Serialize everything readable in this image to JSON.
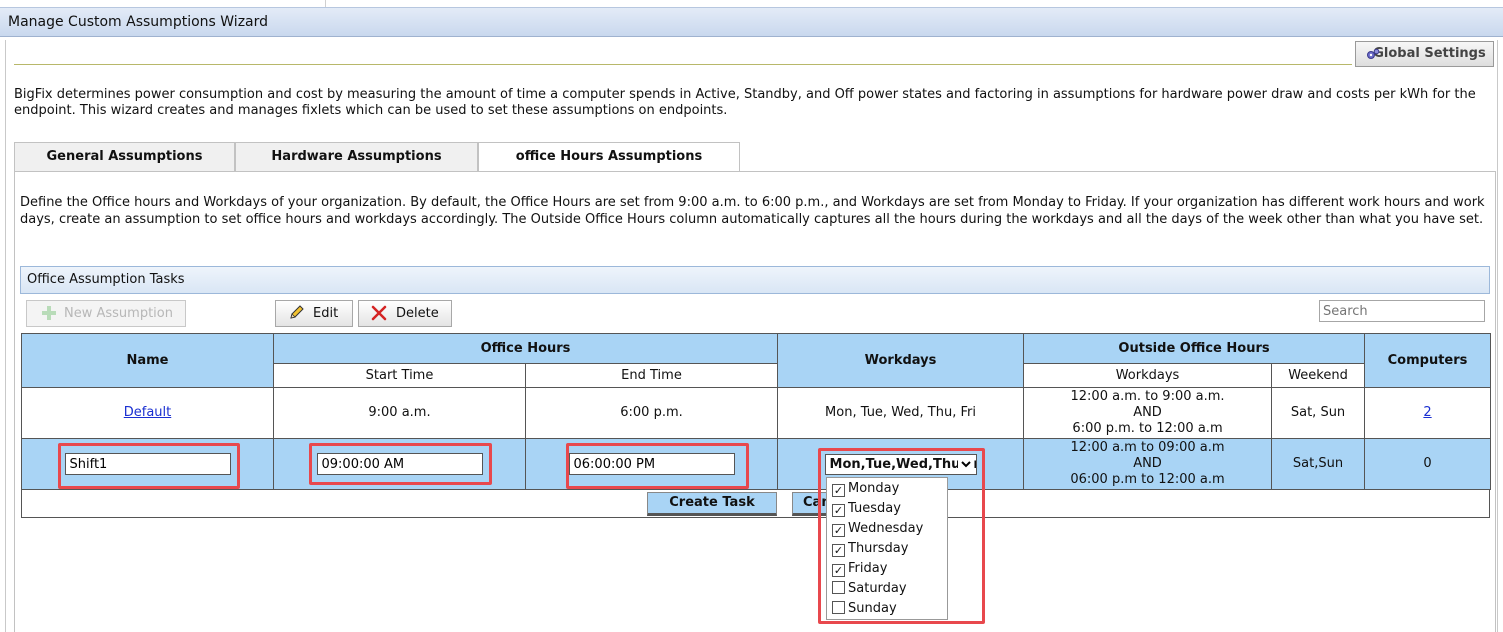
{
  "window": {
    "title": "Manage Custom Assumptions Wizard"
  },
  "header": {
    "global_settings_label": "Global Settings"
  },
  "intro": "BigFix determines power consumption and cost by measuring the amount of time a computer spends in Active, Standby, and Off power states and factoring in assumptions for hardware power draw and costs per kWh for the endpoint. This wizard creates and manages fixlets which can be used to set these assumptions on endpoints.",
  "tabs": [
    {
      "label": "General Assumptions"
    },
    {
      "label": "Hardware Assumptions"
    },
    {
      "label": "office Hours Assumptions"
    }
  ],
  "description": "Define the Office hours and Workdays of your organization. By default, the Office Hours are set from 9:00 a.m. to 6:00 p.m., and Workdays are set from Monday to Friday. If your organization has different work hours and work days, create an assumption to set office hours and workdays accordingly. The Outside Office Hours column automatically captures all the hours during the workdays and all the days of the week other than what you have set.",
  "tasks": {
    "title": "Office Assumption Tasks",
    "new_label": "New Assumption",
    "edit_label": "Edit",
    "delete_label": "Delete",
    "search_placeholder": "Search"
  },
  "table": {
    "headers": {
      "name": "Name",
      "office_hours": "Office Hours",
      "start_time": "Start Time",
      "end_time": "End Time",
      "workdays": "Workdays",
      "outside": "Outside Office Hours",
      "outside_workdays": "Workdays",
      "weekend": "Weekend",
      "computers": "Computers"
    },
    "default_row": {
      "name": "Default",
      "start": "9:00 a.m.",
      "end": "6:00 p.m.",
      "workdays": "Mon, Tue, Wed, Thu, Fri",
      "outside_line1": "12:00 a.m. to 9:00 a.m.",
      "outside_line2": "AND",
      "outside_line3": "6:00 p.m. to 12:00 a.m",
      "weekend": "Sat, Sun",
      "computers": "2"
    },
    "edit_row": {
      "name": "Shift1",
      "start": "09:00:00 AM",
      "end": "06:00:00 PM",
      "workdays_selected": "Mon,Tue,Wed,Thu,Fri",
      "outside_line1": "12:00 a.m to 09:00 a.m",
      "outside_line2": "AND",
      "outside_line3": "06:00 p.m to 12:00 a.m",
      "weekend": "Sat,Sun",
      "computers": "0"
    }
  },
  "actions": {
    "create_label": "Create Task",
    "cancel_label": "Cancel"
  },
  "workday_options": [
    {
      "label": "Monday",
      "checked": true
    },
    {
      "label": "Tuesday",
      "checked": true
    },
    {
      "label": "Wednesday",
      "checked": true
    },
    {
      "label": "Thursday",
      "checked": true
    },
    {
      "label": "Friday",
      "checked": true
    },
    {
      "label": "Saturday",
      "checked": false
    },
    {
      "label": "Sunday",
      "checked": false
    }
  ],
  "colors": {
    "accent": "#a9d4f5",
    "highlight": "#e8484d",
    "link": "#1a2fd1"
  }
}
